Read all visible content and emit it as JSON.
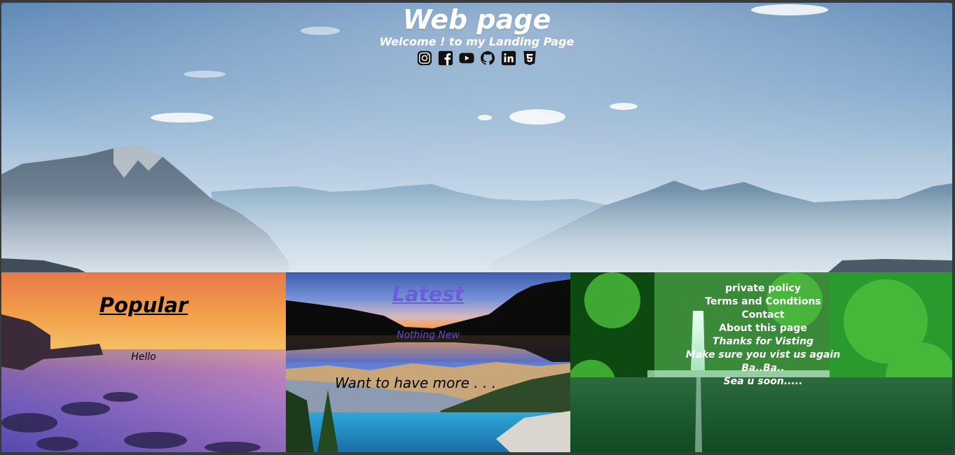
{
  "header": {
    "title": "Web page",
    "subtitle": "Welcome ! to my Landing Page",
    "socials": [
      {
        "name": "instagram-icon"
      },
      {
        "name": "facebook-icon"
      },
      {
        "name": "youtube-icon"
      },
      {
        "name": "github-icon"
      },
      {
        "name": "linkedin-icon"
      },
      {
        "name": "html5-icon"
      }
    ]
  },
  "popular": {
    "title": "Popular",
    "text": "Hello"
  },
  "latest": {
    "title": "Latest",
    "text": "Nothing New"
  },
  "more": {
    "text": "Want to have more . . ."
  },
  "footer": {
    "links": [
      "private policy",
      "Terms and Condtions",
      "Contact",
      "About this page"
    ],
    "messages": [
      "Thanks for Visting",
      "Make sure you vist us again",
      "Ba..Ba..",
      "Sea u soon....."
    ]
  },
  "colors": {
    "latest_accent": "#6a5ed8",
    "text_dark": "#000000",
    "text_light": "#ffffff"
  }
}
